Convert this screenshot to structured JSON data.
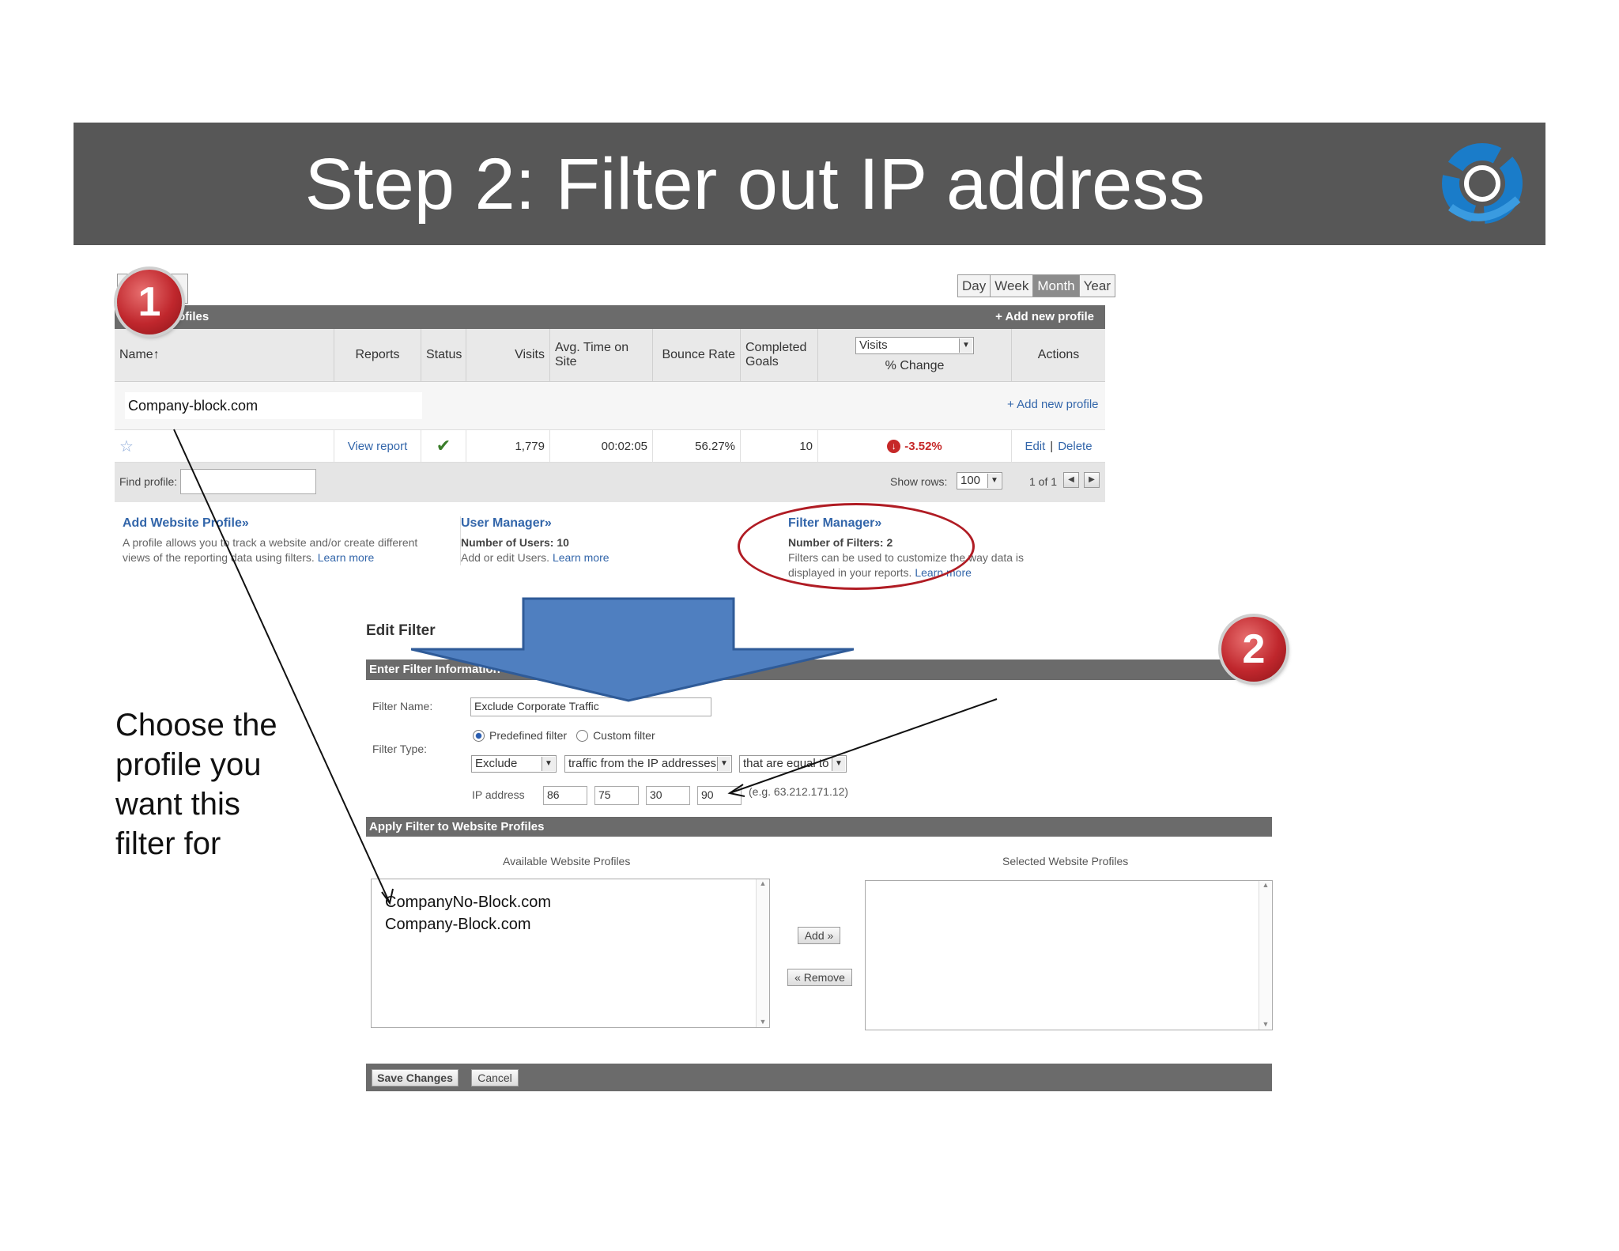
{
  "slide": {
    "title": "Step 2: Filter out IP address"
  },
  "date_range": {
    "day": "Day",
    "week": "Week",
    "month": "Month",
    "year": "Year"
  },
  "profiles_bar": {
    "label": "ofiles",
    "add_label": "+ Add new profile"
  },
  "table": {
    "headers": {
      "name": "Name",
      "reports": "Reports",
      "status": "Status",
      "visits": "Visits",
      "avg_time_1": "Avg. Time on",
      "avg_time_2": "Site",
      "bounce": "Bounce Rate",
      "goals_1": "Completed",
      "goals_2": "Goals",
      "metric_select": "Visits",
      "change": "% Change",
      "actions": "Actions"
    },
    "account_name": "Company-block.com",
    "add_profile": "+ Add new profile",
    "row": {
      "view_report": "View report",
      "visits": "1,779",
      "avg_time": "00:02:05",
      "bounce": "56.27%",
      "goals": "10",
      "change": "-3.52%",
      "edit": "Edit",
      "sep": "|",
      "delete": "Delete"
    },
    "footer": {
      "find_label": "Find profile:",
      "show_rows_label": "Show rows:",
      "show_rows_value": "100",
      "pagination": "1 of 1"
    }
  },
  "info": {
    "add_website": {
      "title": "Add Website Profile»",
      "text": "A profile allows you to track a website and/or create different views of the reporting data using filters.",
      "link": "Learn more"
    },
    "user_manager": {
      "title": "User Manager»",
      "count": "Number of Users: 10",
      "text": "Add or edit Users.",
      "link": "Learn more"
    },
    "filter_manager": {
      "title": "Filter Manager»",
      "count": "Number of Filters: 2",
      "text": "Filters can be used to customize the way data is displayed in your reports.",
      "link": "Learn more"
    }
  },
  "badges": {
    "one": "1",
    "two": "2"
  },
  "edit_filter": {
    "title": "Edit Filter",
    "section": "Enter Filter Information",
    "filter_name_label": "Filter Name:",
    "filter_name_value": "Exclude Corporate Traffic",
    "filter_type_label": "Filter Type:",
    "predefined": "Predefined filter",
    "custom": "Custom filter",
    "exclude": "Exclude",
    "traffic": "traffic from the IP addresses",
    "equal": "that are equal to",
    "ip_label": "IP address",
    "ip": [
      "86",
      "75",
      "30",
      "90"
    ],
    "ip_example": "(e.g. 63.212.171.12)"
  },
  "apply": {
    "section": "Apply Filter to Website Profiles",
    "available_label": "Available Website Profiles",
    "selected_label": "Selected Website Profiles",
    "available": [
      "CompanyNo-Block.com",
      "Company-Block.com"
    ],
    "add_btn": "Add »",
    "remove_btn": "« Remove"
  },
  "actions": {
    "save": "Save Changes",
    "cancel": "Cancel"
  },
  "annotation": {
    "line1": "Choose the",
    "line2": "profile you",
    "line3": "want this",
    "line4": "filter for"
  },
  "colors": {
    "banner": "#575757",
    "accent_red": "#b01c24",
    "arrow_blue": "#4f7fc0",
    "link_blue": "#3366aa"
  }
}
